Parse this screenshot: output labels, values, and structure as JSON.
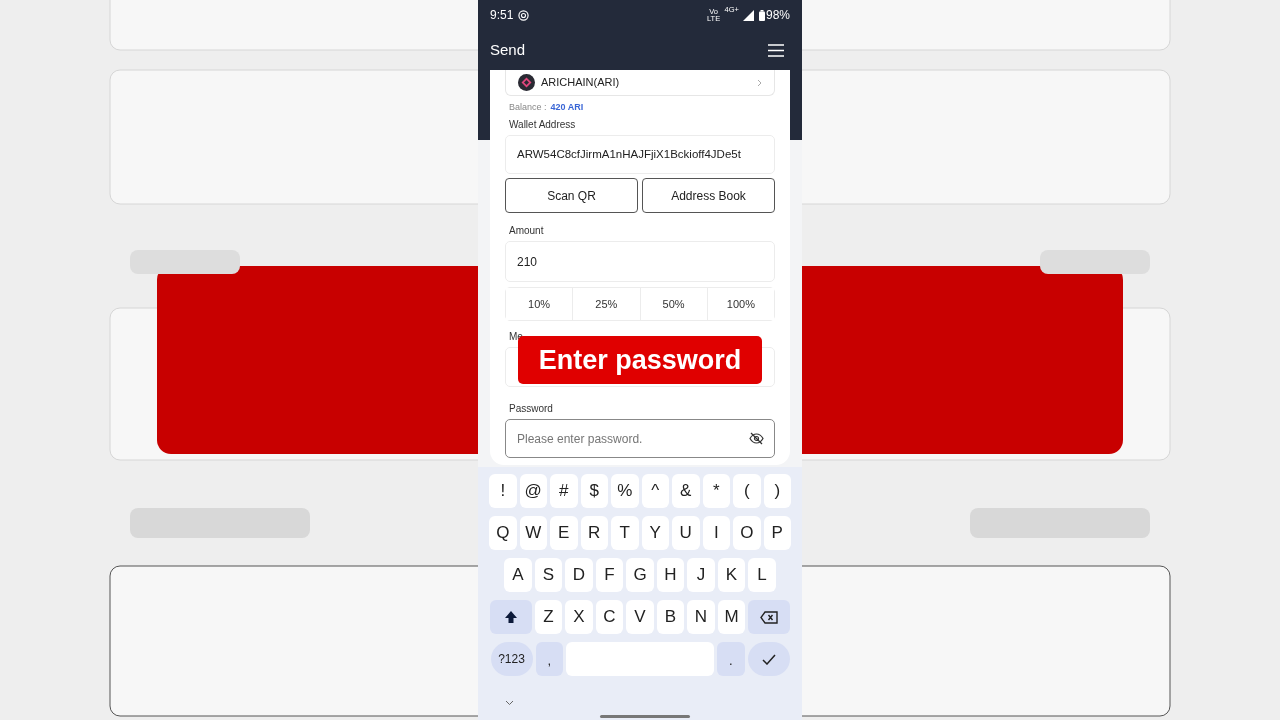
{
  "status_bar": {
    "time": "9:51",
    "network_labels": [
      "Vo LTE",
      "4G+"
    ],
    "battery": "98%"
  },
  "header": {
    "title": "Send"
  },
  "form": {
    "token": {
      "name": "ARICHAIN(ARI)"
    },
    "balance_label": "Balance :",
    "balance_value": "420 ARI",
    "wallet_label": "Wallet Address",
    "wallet_value": "ARW54C8cfJirmA1nHAJFjiX1Bckioff4JDe5t",
    "buttons": [
      "Scan QR",
      "Address Book"
    ],
    "amount_label": "Amount",
    "amount_value": "210",
    "percent_buttons": [
      "10%",
      "25%",
      "50%",
      "100%"
    ],
    "memo_label": "Me",
    "password_label": "Password",
    "password_placeholder": "Please enter password."
  },
  "caption": "Enter password",
  "keyboard": {
    "rows": [
      [
        {
          "kind": "char",
          "label": "!"
        },
        {
          "kind": "char",
          "label": "@"
        },
        {
          "kind": "char",
          "label": "#"
        },
        {
          "kind": "char",
          "label": "$"
        },
        {
          "kind": "char",
          "label": "%"
        },
        {
          "kind": "char",
          "label": "^"
        },
        {
          "kind": "char",
          "label": "&"
        },
        {
          "kind": "char",
          "label": "*"
        },
        {
          "kind": "char",
          "label": "("
        },
        {
          "kind": "char",
          "label": ")"
        }
      ],
      [
        {
          "kind": "char",
          "label": "Q"
        },
        {
          "kind": "char",
          "label": "W"
        },
        {
          "kind": "char",
          "label": "E"
        },
        {
          "kind": "char",
          "label": "R"
        },
        {
          "kind": "char",
          "label": "T"
        },
        {
          "kind": "char",
          "label": "Y"
        },
        {
          "kind": "char",
          "label": "U"
        },
        {
          "kind": "char",
          "label": "I"
        },
        {
          "kind": "char",
          "label": "O"
        },
        {
          "kind": "char",
          "label": "P"
        }
      ],
      [
        {
          "kind": "char",
          "label": "A"
        },
        {
          "kind": "char",
          "label": "S"
        },
        {
          "kind": "char",
          "label": "D"
        },
        {
          "kind": "char",
          "label": "F"
        },
        {
          "kind": "char",
          "label": "G"
        },
        {
          "kind": "char",
          "label": "H"
        },
        {
          "kind": "char",
          "label": "J"
        },
        {
          "kind": "char",
          "label": "K"
        },
        {
          "kind": "char",
          "label": "L"
        }
      ],
      [
        {
          "kind": "shift"
        },
        {
          "kind": "char",
          "label": "Z"
        },
        {
          "kind": "char",
          "label": "X"
        },
        {
          "kind": "char",
          "label": "C"
        },
        {
          "kind": "char",
          "label": "V"
        },
        {
          "kind": "char",
          "label": "B"
        },
        {
          "kind": "char",
          "label": "N"
        },
        {
          "kind": "char",
          "label": "M"
        },
        {
          "kind": "backspace"
        }
      ],
      [
        {
          "kind": "mode",
          "label": "?123"
        },
        {
          "kind": "punct",
          "label": ","
        },
        {
          "kind": "space"
        },
        {
          "kind": "punct",
          "label": "."
        },
        {
          "kind": "enter"
        }
      ]
    ]
  }
}
